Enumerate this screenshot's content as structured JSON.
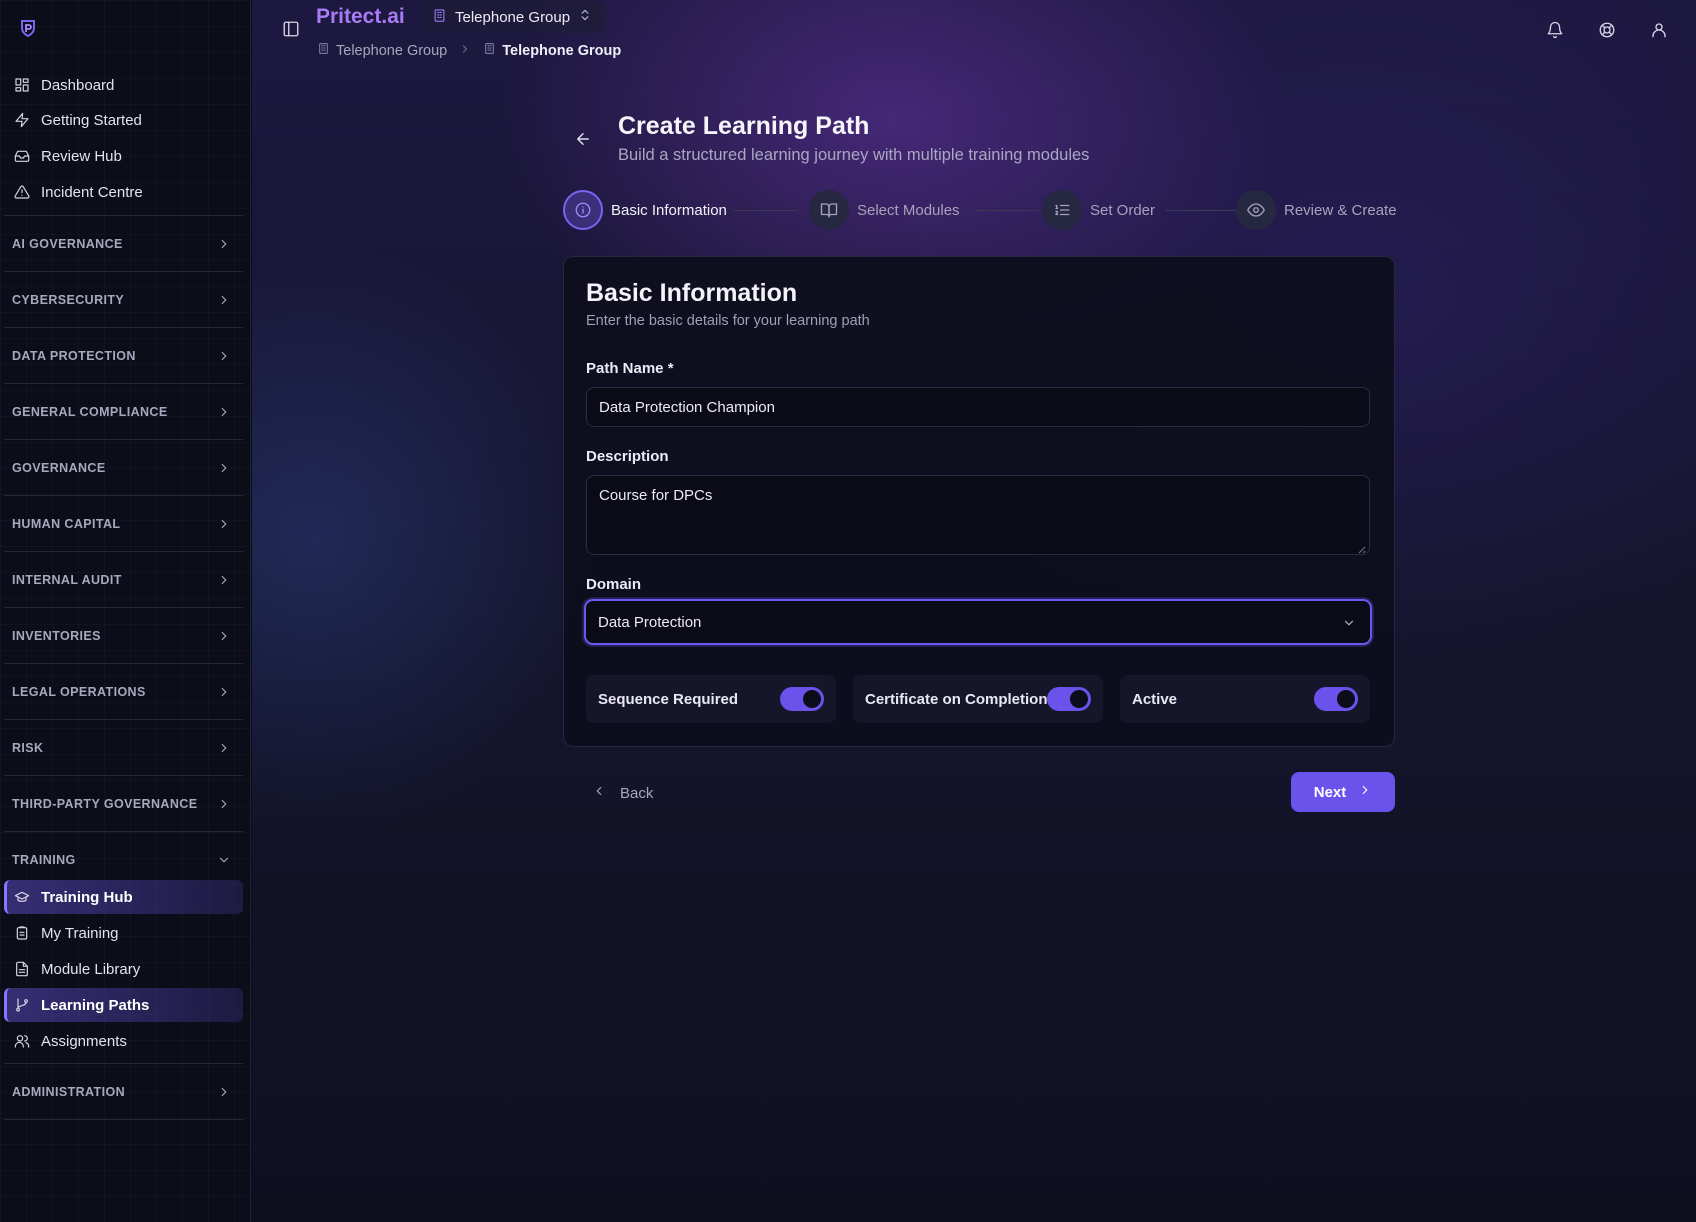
{
  "app": {
    "brand": "Pritect.ai",
    "org_switcher": "Telephone Group",
    "breadcrumb": [
      "Telephone Group",
      "Telephone Group"
    ]
  },
  "sidebar": {
    "top_items": [
      {
        "label": "Dashboard",
        "icon": "dashboard-icon"
      },
      {
        "label": "Getting Started",
        "icon": "lightning-icon"
      },
      {
        "label": "Review Hub",
        "icon": "inbox-icon"
      },
      {
        "label": "Incident Centre",
        "icon": "alert-triangle-icon"
      }
    ],
    "sections": [
      "AI GOVERNANCE",
      "CYBERSECURITY",
      "DATA PROTECTION",
      "GENERAL COMPLIANCE",
      "GOVERNANCE",
      "HUMAN CAPITAL",
      "INTERNAL AUDIT",
      "INVENTORIES",
      "LEGAL OPERATIONS",
      "RISK",
      "THIRD-PARTY GOVERNANCE"
    ],
    "training_section": "TRAINING",
    "training_items": [
      {
        "label": "Training Hub",
        "icon": "graduation-cap-icon",
        "active": true
      },
      {
        "label": "My Training",
        "icon": "clipboard-icon",
        "active": false
      },
      {
        "label": "Module Library",
        "icon": "file-text-icon",
        "active": false
      },
      {
        "label": "Learning Paths",
        "icon": "git-branch-icon",
        "active": true
      },
      {
        "label": "Assignments",
        "icon": "users-icon",
        "active": false
      }
    ],
    "admin_section": "ADMINISTRATION"
  },
  "page": {
    "title": "Create Learning Path",
    "subtitle": "Build a structured learning journey with multiple training modules"
  },
  "stepper": [
    {
      "label": "Basic Information",
      "icon": "info-icon",
      "active": true
    },
    {
      "label": "Select Modules",
      "icon": "book-open-icon",
      "active": false
    },
    {
      "label": "Set Order",
      "icon": "list-ordered-icon",
      "active": false
    },
    {
      "label": "Review & Create",
      "icon": "eye-icon",
      "active": false
    }
  ],
  "form": {
    "title": "Basic Information",
    "subtitle": "Enter the basic details for your learning path",
    "path_name_label": "Path Name *",
    "path_name_value": "Data Protection Champion",
    "description_label": "Description",
    "description_value": "Course for DPCs",
    "domain_label": "Domain",
    "domain_value": "Data Protection",
    "toggles": [
      {
        "label": "Sequence Required",
        "on": true
      },
      {
        "label": "Certificate on Completion",
        "on": true
      },
      {
        "label": "Active",
        "on": true
      }
    ]
  },
  "actions": {
    "back_label": "Back",
    "next_label": "Next"
  },
  "colors": {
    "accent": "#6a52ea",
    "brand": "#a77bf3",
    "sidebar_bg": "#0b0d19"
  }
}
